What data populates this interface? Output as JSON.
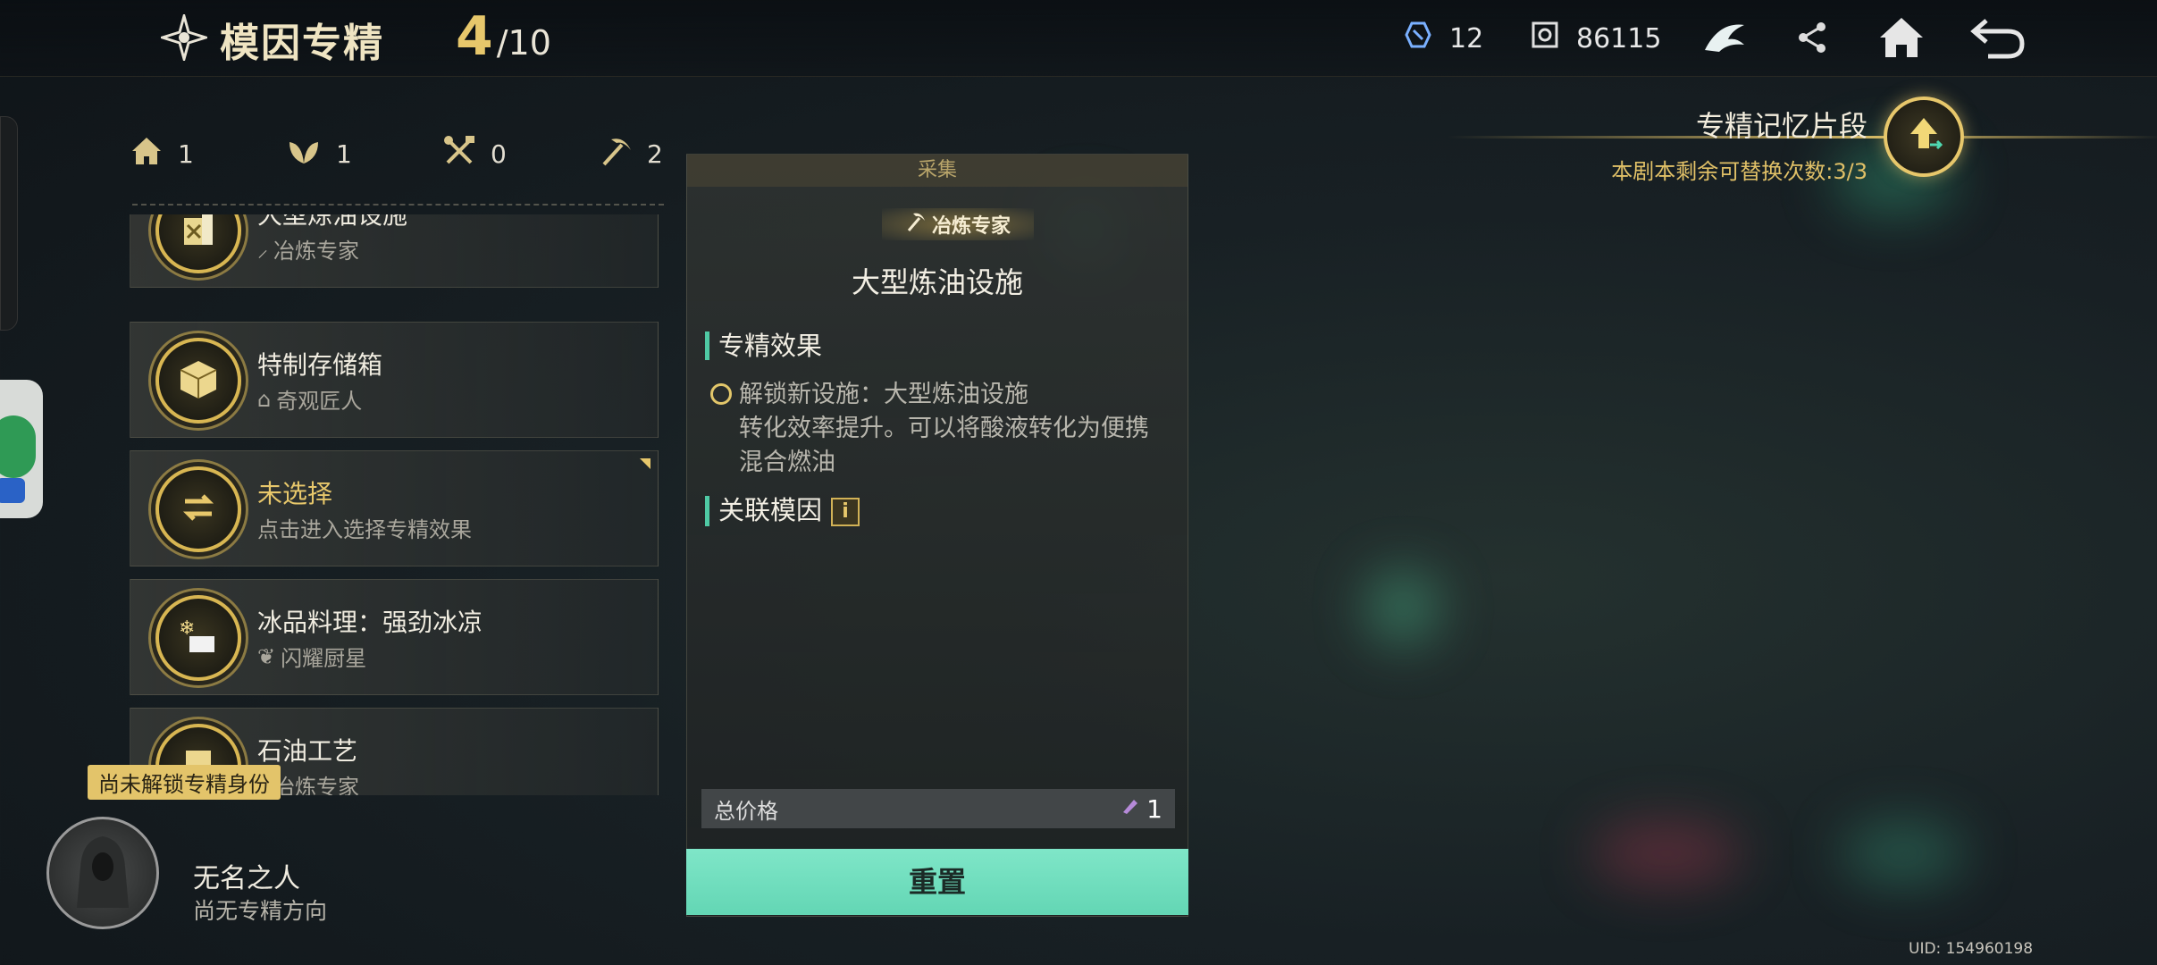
{
  "header": {
    "title": "模因专精",
    "progress_current": "4",
    "progress_total": "/10",
    "resource1_value": "12",
    "resource2_value": "86115"
  },
  "stats": [
    {
      "icon": "house-icon",
      "value": "1"
    },
    {
      "icon": "leaf-icon",
      "value": "1"
    },
    {
      "icon": "tools-icon",
      "value": "0"
    },
    {
      "icon": "pickaxe-icon",
      "value": "2"
    }
  ],
  "cards": [
    {
      "name": "大型炼油设施",
      "sub": "冶炼专家",
      "sub_icon": "pickaxe-icon"
    },
    {
      "name": "特制存储箱",
      "sub": "奇观匠人",
      "sub_icon": "house-icon"
    },
    {
      "name": "未选择",
      "sub": "点击进入选择专精效果",
      "sub_icon": ""
    },
    {
      "name": "冰品料理：强劲冰凉",
      "sub": "闪耀厨星",
      "sub_icon": "leaf-icon"
    },
    {
      "name": "石油工艺",
      "sub": "冶炼专家",
      "sub_icon": "pickaxe-icon"
    }
  ],
  "detail": {
    "category": "采集",
    "role": "冶炼专家",
    "title": "大型炼油设施",
    "effect_heading": "专精效果",
    "effect_line1": "解锁新设施：大型炼油设施",
    "effect_line2": "转化效率提升。可以将酸液转化为便携混合燃油",
    "related_heading": "关联模因",
    "info_badge": "i",
    "price_label": "总价格",
    "price_value": "1",
    "reset_label": "重置"
  },
  "memory": {
    "title": "专精记忆片段",
    "subtitle": "本剧本剩余可替换次数:3/3"
  },
  "player": {
    "tag": "尚未解锁专精身份",
    "name": "无名之人",
    "direction": "尚无专精方向"
  },
  "uid": "UID: 154960198",
  "colors": {
    "accent_gold": "#e7c76b",
    "accent_teal": "#63d6b4"
  }
}
